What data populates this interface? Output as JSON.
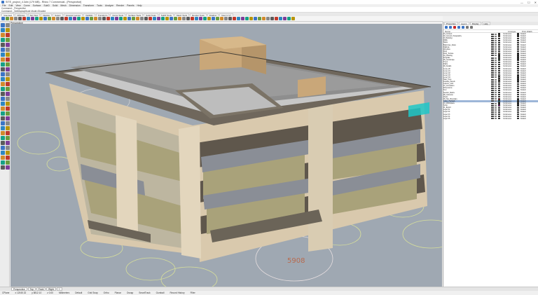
{
  "window": {
    "title": "SITE_project_4.3dm (179 MB) - Rhino 7 Commercial - [Perspective]",
    "controls": [
      "—",
      "☐",
      "✕"
    ]
  },
  "menu": [
    "File",
    "Edit",
    "View",
    "Curve",
    "Surface",
    "SubD",
    "Solid",
    "Mesh",
    "Dimension",
    "Transform",
    "Tools",
    "Analyze",
    "Render",
    "Panels",
    "Help"
  ],
  "command_history": [
    "Command: _Perspective",
    "Command: _SetDisplayMode Mode=Shaded",
    "Command:"
  ],
  "toolbar_tabs": [
    "Standard",
    "CPlanes",
    "Set View",
    "Display",
    "Select",
    "Viewport Layout",
    "Visibility",
    "Transform",
    "Curve Tools",
    "Surface Tools",
    "Solid Tools",
    "SubD Tools",
    "Mesh Tools",
    "Render Tools",
    "Drafting",
    "New in V7"
  ],
  "viewport": {
    "label": "Perspective",
    "dimension_text": "5908"
  },
  "bottom_tabs": [
    "Perspective",
    "Top",
    "Front",
    "Right",
    "+"
  ],
  "status": [
    "CPlane",
    "x 12045.32",
    "y 8812.10",
    "z 0.00",
    "Millimeters",
    "Default",
    "Grid Snap",
    "Ortho",
    "Planar",
    "Osnap",
    "SmartTrack",
    "Gumball",
    "Record History",
    "Filter"
  ],
  "panel": {
    "tabs": [
      "Properties",
      "Layers",
      "Display",
      "Help"
    ],
    "headers": [
      "Name",
      "Linetype",
      "Print Width"
    ],
    "layers": [
      {
        "name": "01_Context",
        "color": "#000000",
        "lt": "Continuous",
        "pw": "Default"
      },
      {
        "name": "  02_Ground_Topography",
        "color": "#7a5b3a",
        "lt": "Continuous",
        "pw": "Default"
      },
      {
        "name": "  03_Building",
        "color": "#000000",
        "lt": "Continuous",
        "pw": "Default"
      },
      {
        "name": "    Walls",
        "color": "#d4c1a4",
        "lt": "Continuous",
        "pw": "Default"
      },
      {
        "name": "    Slabs",
        "color": "#5f574c",
        "lt": "Continuous",
        "pw": "Default"
      },
      {
        "name": "    Balconies_Glass",
        "color": "#7fb0d0",
        "lt": "Continuous",
        "pw": "Default"
      },
      {
        "name": "    Railings",
        "color": "#333333",
        "lt": "Continuous",
        "pw": "Default"
      },
      {
        "name": "    Windows",
        "color": "#a9b48a",
        "lt": "Continuous",
        "pw": "Default"
      },
      {
        "name": "    Roof",
        "color": "#8a8a8a",
        "lt": "Continuous",
        "pw": "Default"
      },
      {
        "name": "    Roof_Terrace",
        "color": "#c9a779",
        "lt": "Continuous",
        "pw": "Default"
      },
      {
        "name": "  04_Shading",
        "color": "#000000",
        "lt": "Continuous",
        "pw": "Default"
      },
      {
        "name": "    Pergolas",
        "color": "#4f4a42",
        "lt": "Continuous",
        "pw": "Default"
      },
      {
        "name": "  05_Landscape",
        "color": "#2e7d32",
        "lt": "Continuous",
        "pw": "Default"
      },
      {
        "name": "    Trees",
        "color": "#c9d36b",
        "lt": "Continuous",
        "pw": "Default"
      },
      {
        "name": "    Paths",
        "color": "#b98b6f",
        "lt": "Continuous",
        "pw": "Default"
      },
      {
        "name": "  06_Details",
        "color": "#000000",
        "lt": "Continuous",
        "pw": "Default"
      },
      {
        "name": "    Level_00",
        "color": "#e0e0e0",
        "lt": "Continuous",
        "pw": "Default"
      },
      {
        "name": "    Level_01",
        "color": "#e0e0e0",
        "lt": "Continuous",
        "pw": "Default"
      },
      {
        "name": "    Level_02",
        "color": "#e0e0e0",
        "lt": "Continuous",
        "pw": "Default"
      },
      {
        "name": "    Level_03",
        "color": "#e0e0e0",
        "lt": "Continuous",
        "pw": "Default"
      },
      {
        "name": "    Level_04",
        "color": "#e0e0e0",
        "lt": "Continuous",
        "pw": "Default"
      },
      {
        "name": "    Stair_Core",
        "color": "#cbbfa8",
        "lt": "Continuous",
        "pw": "Default"
      },
      {
        "name": "    Facade_Panels",
        "color": "#9e8f78",
        "lt": "Continuous",
        "pw": "Default"
      },
      {
        "name": "    Column_Grid",
        "color": "#555555",
        "lt": "Continuous",
        "pw": "Default"
      },
      {
        "name": "  07_Annotation",
        "color": "#d32f2f",
        "lt": "Continuous",
        "pw": "Default"
      },
      {
        "name": "    Dimensions",
        "color": "#b86a4e",
        "lt": "Continuous",
        "pw": "Default"
      },
      {
        "name": "    Text",
        "color": "#000000",
        "lt": "Continuous",
        "pw": "Default"
      },
      {
        "name": "    Section_Marks",
        "color": "#000000",
        "lt": "Continuous",
        "pw": "Default"
      },
      {
        "name": "  08_Cameras",
        "color": "#1565c0",
        "lt": "Continuous",
        "pw": "Default"
      },
      {
        "name": "    Views",
        "color": "#1565c0",
        "lt": "Continuous",
        "pw": "Default"
      },
      {
        "name": "  09_Site_Boundary",
        "color": "#ff0000",
        "lt": "Continuous",
        "pw": "Default"
      },
      {
        "name": "    Glass_Highlight",
        "color": "#1ec7c7",
        "lt": "Continuous",
        "pw": "Default",
        "selected": true
      },
      {
        "name": "  10_Workspace",
        "color": "#000000",
        "lt": "Continuous",
        "pw": "Default"
      },
      {
        "name": "    Temp",
        "color": "#ff00ff",
        "lt": "Continuous",
        "pw": "Default"
      },
      {
        "name": "  11_Export",
        "color": "#000000",
        "lt": "Continuous",
        "pw": "Default"
      },
      {
        "name": "    Layer 01",
        "color": "#000000",
        "lt": "Continuous",
        "pw": "Default"
      },
      {
        "name": "    Layer 02",
        "color": "#000000",
        "lt": "Continuous",
        "pw": "Default"
      },
      {
        "name": "    Layer 03",
        "color": "#000000",
        "lt": "Continuous",
        "pw": "Default"
      },
      {
        "name": "    Layer 04",
        "color": "#000000",
        "lt": "Continuous",
        "pw": "Default"
      },
      {
        "name": "    Layer 05",
        "color": "#000000",
        "lt": "Continuous",
        "pw": "Default"
      }
    ]
  },
  "webcam": {
    "name": ""
  },
  "colors": {
    "viewport_bg": "#9fa8b2",
    "accent": "#3b74c5"
  }
}
